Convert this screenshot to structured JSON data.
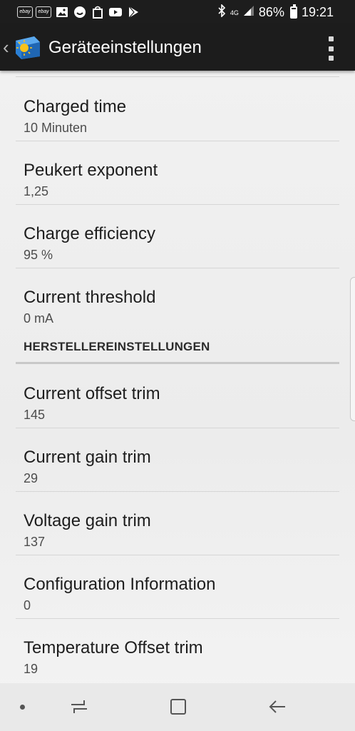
{
  "status_bar": {
    "left_icons": [
      "ebay-icon",
      "ebay-kleinanzeigen-icon",
      "gallery-icon",
      "whatsapp-icon",
      "shopping-bag-icon",
      "youtube-icon",
      "play-store-icon"
    ],
    "ebay_label": "ebay",
    "ebay_kleinanzeigen_label": "ebay",
    "network": "4G",
    "battery": "86%",
    "time": "19:21"
  },
  "app_bar": {
    "title": "Geräteeinstellungen"
  },
  "preferences_top": [
    {
      "title": "Charged time",
      "summary": "10 Minuten"
    },
    {
      "title": "Peukert exponent",
      "summary": "1,25"
    },
    {
      "title": "Charge efficiency",
      "summary": "95 %"
    },
    {
      "title": "Current threshold",
      "summary": "0 mA"
    }
  ],
  "category": {
    "title": "HERSTELLEREINSTELLUNGEN"
  },
  "preferences_bottom": [
    {
      "title": "Current offset trim",
      "summary": "145"
    },
    {
      "title": "Current gain trim",
      "summary": "29"
    },
    {
      "title": "Voltage gain trim",
      "summary": "137"
    },
    {
      "title": "Configuration Information",
      "summary": "0"
    },
    {
      "title": "Temperature Offset trim",
      "summary": "19"
    }
  ],
  "colors": {
    "app_bar_bg": "#1c1c1c",
    "status_bar_bg": "#1d1d1d",
    "content_bg": "#f0f0f0",
    "nav_bar_bg": "#e9e9e9"
  }
}
